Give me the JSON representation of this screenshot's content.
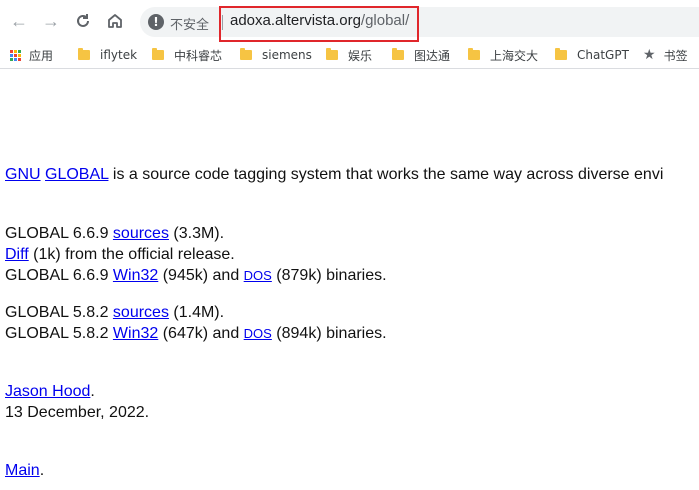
{
  "browser": {
    "back_icon": "arrow-left",
    "forward_icon": "arrow-right",
    "reload_icon": "reload",
    "home_icon": "home",
    "security_label": "不安全",
    "url_host": "adoxa.altervista.org",
    "url_path": "/global/"
  },
  "bookmarks": [
    {
      "label": "应用",
      "type": "apps"
    },
    {
      "label": "iflytek",
      "type": "folder"
    },
    {
      "label": "中科睿芯",
      "type": "folder"
    },
    {
      "label": "siemens",
      "type": "folder"
    },
    {
      "label": "娱乐",
      "type": "folder"
    },
    {
      "label": "图达通",
      "type": "folder"
    },
    {
      "label": "上海交大",
      "type": "folder"
    },
    {
      "label": "ChatGPT",
      "type": "folder"
    },
    {
      "label": "书签",
      "type": "star"
    }
  ],
  "page": {
    "intro": {
      "link1": "GNU",
      "link2": "GLOBAL",
      "text": " is a source code tagging system that works the same way across diverse envi"
    },
    "r669": {
      "line1_prefix": "GLOBAL 6.6.9 ",
      "line1_link": "sources",
      "line1_suffix": " (3.3M).",
      "line2_link": "Diff",
      "line2_suffix": " (1k) from the official release.",
      "line3_prefix": "GLOBAL 6.6.9 ",
      "line3_link1": "Win32",
      "line3_mid": " (945k) and ",
      "line3_link2": "DOS",
      "line3_suffix": " (879k) binaries."
    },
    "r582": {
      "line1_prefix": "GLOBAL 5.8.2 ",
      "line1_link": "sources",
      "line1_suffix": " (1.4M).",
      "line2_prefix": "GLOBAL 5.8.2 ",
      "line2_link1": "Win32",
      "line2_mid": " (647k) and ",
      "line2_link2": "DOS",
      "line2_suffix": " (894k) binaries."
    },
    "author": {
      "link": "Jason Hood",
      "suffix": ".",
      "date": "13 December, 2022."
    },
    "footer": {
      "link": "Main",
      "suffix": "."
    }
  }
}
